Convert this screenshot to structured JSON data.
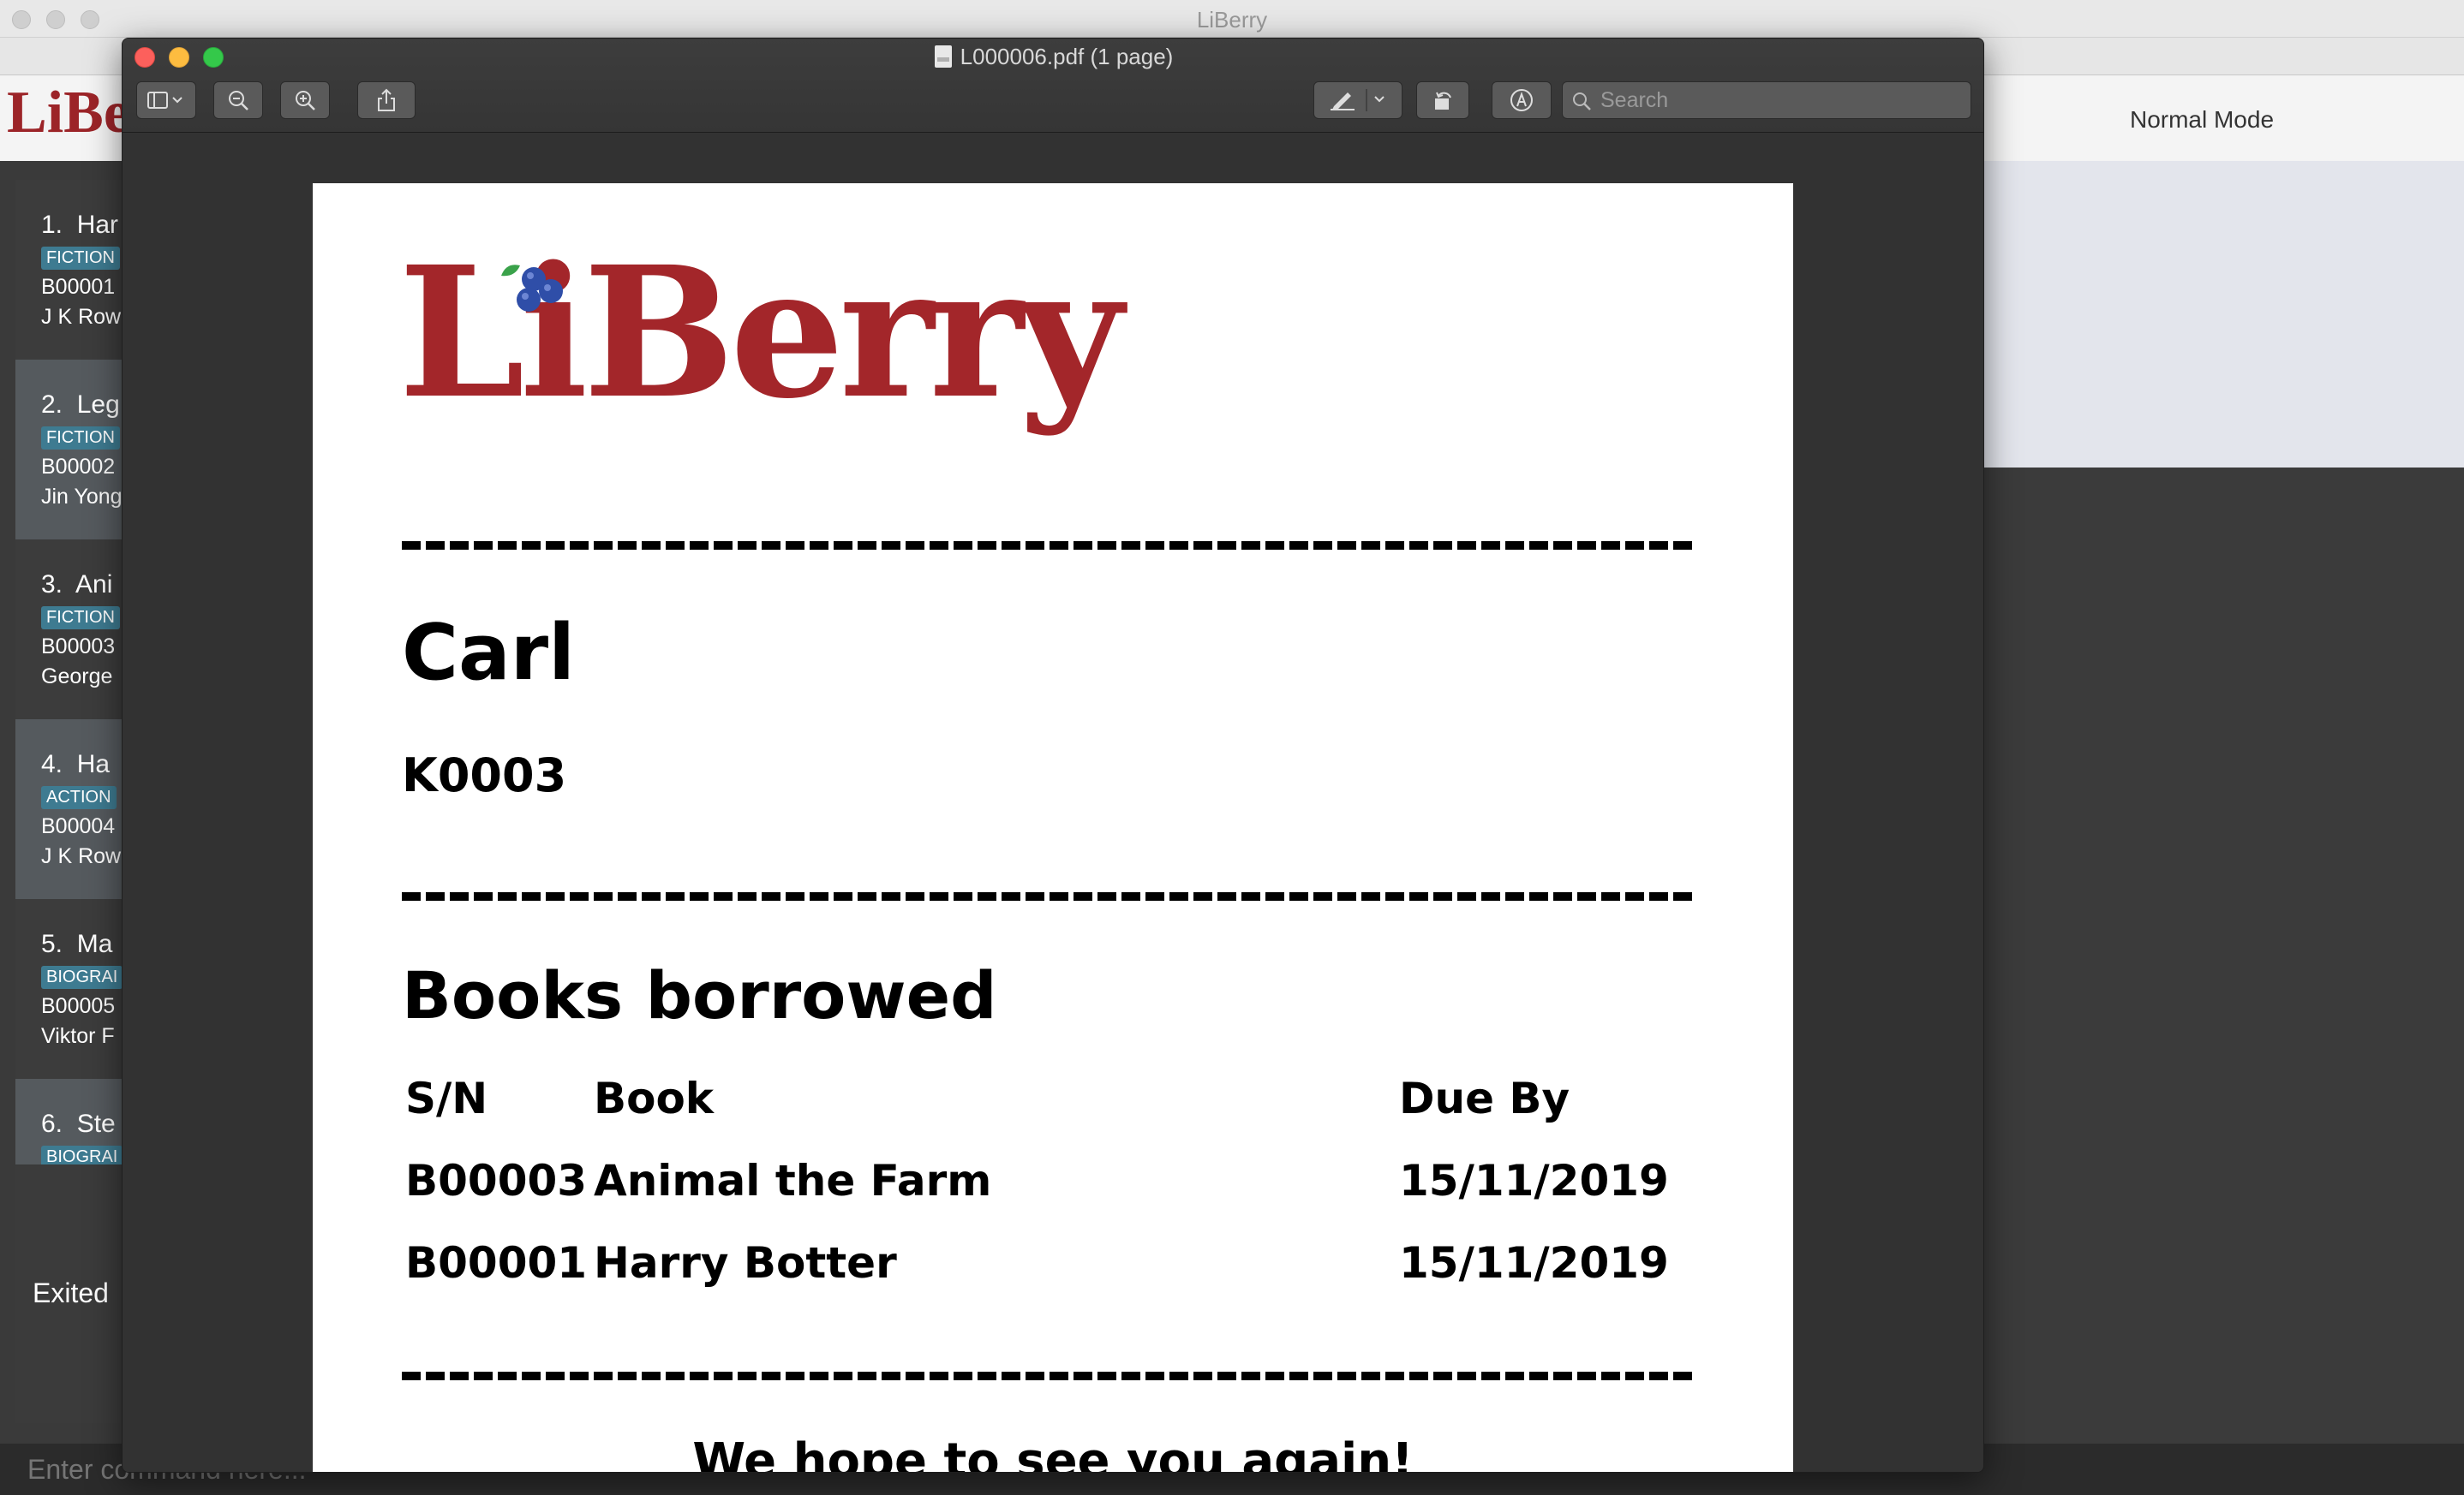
{
  "app": {
    "window_title": "LiBerry",
    "logo_text": "LiBe",
    "mode": "Normal Mode",
    "books": [
      {
        "index": "1.",
        "title": "Har",
        "tag": "FICTION",
        "id": "B00001",
        "author": "J K Row"
      },
      {
        "index": "2.",
        "title": "Leg",
        "tag": "FICTION",
        "id": "B00002",
        "author": "Jin Yong"
      },
      {
        "index": "3.",
        "title": "Ani",
        "tag": "FICTION",
        "id": "B00003",
        "author": "George"
      },
      {
        "index": "4.",
        "title": "Ha",
        "tag": "ACTION",
        "id": "B00004",
        "author": "J K Row"
      },
      {
        "index": "5.",
        "title": "Ma",
        "tag": "BIOGRAI",
        "id": "B00005",
        "author": "Viktor F"
      },
      {
        "index": "6.",
        "title": "Ste",
        "tag": "BIOGRAI",
        "id": "",
        "author": ""
      }
    ],
    "result_text": "Exited",
    "command_placeholder": "Enter command here..."
  },
  "preview": {
    "title": "L000006.pdf (1 page)",
    "search_placeholder": "Search",
    "toolbar_icons": [
      "sidebar-icon",
      "zoom-out-icon",
      "zoom-in-icon",
      "share-icon",
      "markup-pen-icon",
      "rotate-icon",
      "annotate-icon",
      "search-icon"
    ]
  },
  "receipt": {
    "logo_text": "LiBerry",
    "member_name": "Carl",
    "member_id": "K0003",
    "section_title": "Books borrowed",
    "columns": [
      "S/N",
      "Book",
      "Due By"
    ],
    "rows": [
      {
        "sn": "B00003",
        "book": "Animal the Farm",
        "due": "15/11/2019"
      },
      {
        "sn": "B00001",
        "book": "Harry Botter",
        "due": "15/11/2019"
      }
    ],
    "farewell": "We hope to see you again!"
  },
  "colors": {
    "brand_red": "#a3262a",
    "berry_blue": "#2f4ea8",
    "leaf_green": "#3aa24a",
    "tag_blue": "#3e7b91"
  }
}
